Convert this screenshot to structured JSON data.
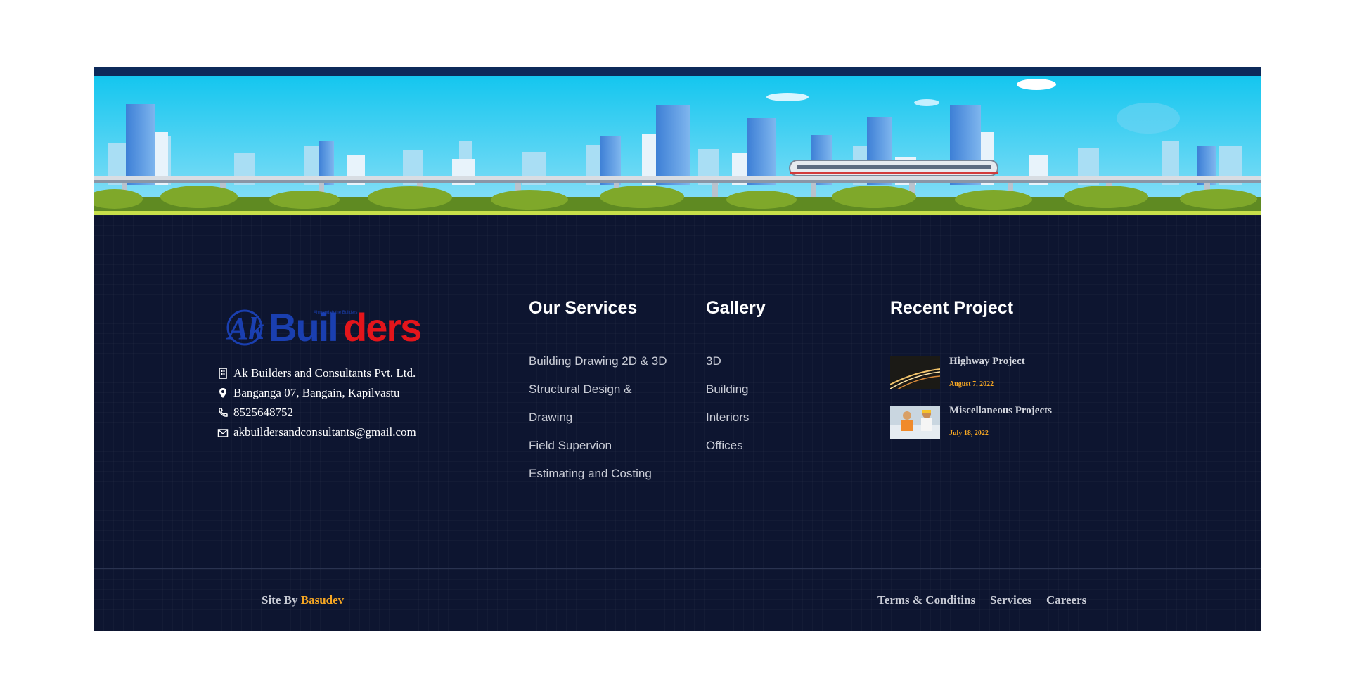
{
  "logo": {
    "brand_ak": "Ak",
    "brand_builders_blue": "Buil",
    "brand_builders_red": "ders",
    "tagline": "Ahmendab the Builders"
  },
  "contact": {
    "company": "Ak Builders and Consultants Pvt. Ltd.",
    "address": "Banganga 07, Bangain, Kapilvastu",
    "phone": "8525648752",
    "email": "akbuildersandconsultants@gmail.com",
    "icons": [
      "building-icon",
      "location-pin-icon",
      "phone-icon",
      "mail-icon"
    ]
  },
  "services": {
    "heading": "Our Services",
    "items": [
      "Building Drawing 2D & 3D",
      "Structural Design &",
      "Drawing",
      "Field Supervion",
      "Estimating and Costing"
    ]
  },
  "gallery": {
    "heading": "Gallery",
    "items": [
      "3D",
      "Building",
      "Interiors",
      "Offices"
    ]
  },
  "recent": {
    "heading": "Recent Project",
    "projects": [
      {
        "title": "Highway Project",
        "date": "August 7, 2022"
      },
      {
        "title": "Miscellaneous Projects",
        "date": "July 18, 2022"
      }
    ]
  },
  "bottom": {
    "site_by": "Site By",
    "author": "Basudev",
    "links": [
      "Terms & Conditins",
      "Services",
      "Careers"
    ]
  },
  "colors": {
    "footer_bg": "#0d1530",
    "accent": "#f5a623",
    "logo_blue": "#1a3fb0",
    "logo_red": "#e3151b"
  }
}
